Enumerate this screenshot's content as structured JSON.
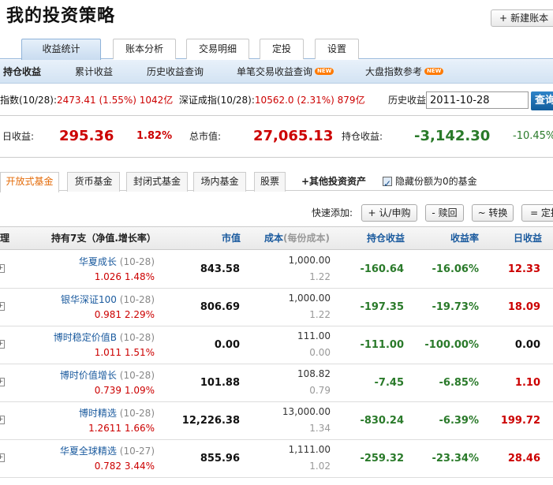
{
  "page": {
    "title": "我的投资策略",
    "new_account_label": "新建账本"
  },
  "main_tabs": [
    "收益统计",
    "账本分析",
    "交易明细",
    "定投",
    "设置"
  ],
  "sub_nav": [
    {
      "label": "持仓收益",
      "badge": ""
    },
    {
      "label": "累计收益",
      "badge": ""
    },
    {
      "label": "历史收益查询",
      "badge": ""
    },
    {
      "label": "单笔交易收益查询",
      "badge": "NEW"
    },
    {
      "label": "大盘指数参考",
      "badge": "NEW"
    }
  ],
  "index_bar": {
    "sh_prefix": "指数(10/28):",
    "sh_value": "2473.41 (1.55%) 1042亿",
    "sz_prefix": "深证成指(10/28):",
    "sz_value": "10562.0 (2.31%) 879亿"
  },
  "history": {
    "label": "历史收益",
    "date_value": "2011-10-28",
    "query_label": "查询"
  },
  "summary": {
    "daily_label": "日收益:",
    "daily_value": "295.36",
    "daily_pct": "1.82%",
    "mv_label": "总市值:",
    "mv_value": "27,065.13",
    "hold_label": "持仓收益:",
    "hold_value": "-3,142.30",
    "hold_pct": "-10.45%"
  },
  "asset_tabs": [
    "开放式基金",
    "货币基金",
    "封闭式基金",
    "场内基金",
    "股票"
  ],
  "asset_extra": {
    "other_label": "+其他投资资产",
    "hide_zero_label": "隐藏份额为0的基金"
  },
  "quick_add": {
    "label": "快速添加:",
    "buttons": [
      "+ 认/申购",
      "- 赎回",
      "~ 转换",
      "= 定投"
    ]
  },
  "table": {
    "header": {
      "col0": "理",
      "holding_prefix": "持有7支（净值.增长率）",
      "market_value": "市值",
      "cost": "成本",
      "cost_sub": "(每份成本)",
      "hold_profit": "持仓收益",
      "return_rate": "收益率",
      "daily_profit": "日收益"
    },
    "rows": [
      {
        "name": "华夏成长",
        "date": "(10-28)",
        "nav": "1.026 1.48%",
        "mv": "843.58",
        "cost": "1,000.00",
        "cost_per": "1.22",
        "hold": "-160.64",
        "rate": "-16.06%",
        "daily": "12.33",
        "daily_color": "red"
      },
      {
        "name": "银华深证100",
        "date": "(10-28)",
        "nav": "0.981 2.29%",
        "mv": "806.69",
        "cost": "1,000.00",
        "cost_per": "1.22",
        "hold": "-197.35",
        "rate": "-19.73%",
        "daily": "18.09",
        "daily_color": "red"
      },
      {
        "name": "博时稳定价值B",
        "date": "(10-28)",
        "nav": "1.011 1.51%",
        "mv": "0.00",
        "cost": "111.00",
        "cost_per": "0.00",
        "hold": "-111.00",
        "rate": "-100.00%",
        "daily": "0.00",
        "daily_color": "black"
      },
      {
        "name": "博时价值增长",
        "date": "(10-28)",
        "nav": "0.739 1.09%",
        "mv": "101.88",
        "cost": "108.82",
        "cost_per": "0.79",
        "hold": "-7.45",
        "rate": "-6.85%",
        "daily": "1.10",
        "daily_color": "red"
      },
      {
        "name": "博时精选",
        "date": "(10-28)",
        "nav": "1.2611 1.66%",
        "mv": "12,226.38",
        "cost": "13,000.00",
        "cost_per": "1.34",
        "hold": "-830.24",
        "rate": "-6.39%",
        "daily": "199.72",
        "daily_color": "red"
      },
      {
        "name": "华夏全球精选",
        "date": "(10-27)",
        "nav": "0.782 3.44%",
        "mv": "855.96",
        "cost": "1,111.00",
        "cost_per": "1.02",
        "hold": "-259.32",
        "rate": "-23.34%",
        "daily": "28.46",
        "daily_color": "red"
      }
    ]
  }
}
